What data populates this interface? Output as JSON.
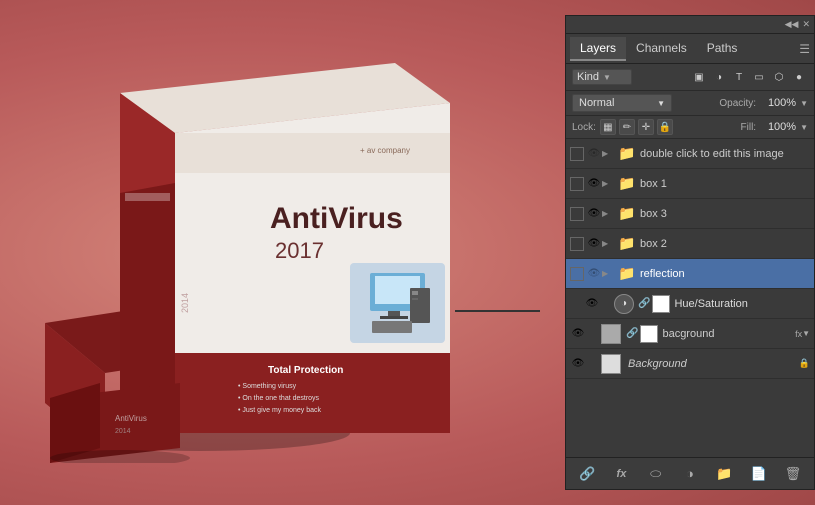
{
  "background_color": "#c97070",
  "panel": {
    "title": "Layers",
    "tabs": [
      {
        "label": "Layers",
        "active": true
      },
      {
        "label": "Channels",
        "active": false
      },
      {
        "label": "Paths",
        "active": false
      }
    ],
    "kind_label": "Kind",
    "blend_mode": "Normal",
    "opacity_label": "Opacity:",
    "opacity_value": "100%",
    "lock_label": "Lock:",
    "fill_label": "Fill:",
    "fill_value": "100%",
    "layers": [
      {
        "id": "layer-double-click",
        "visible": false,
        "has_eye": false,
        "has_arrow": true,
        "type": "folder",
        "name": "double click to edit this image",
        "italic": false,
        "indented": false
      },
      {
        "id": "layer-box1",
        "visible": true,
        "has_eye": true,
        "has_arrow": true,
        "type": "folder",
        "name": "box 1",
        "italic": false,
        "indented": false
      },
      {
        "id": "layer-box3",
        "visible": true,
        "has_eye": true,
        "has_arrow": true,
        "type": "folder",
        "name": "box 3",
        "italic": false,
        "indented": false
      },
      {
        "id": "layer-box2",
        "visible": true,
        "has_eye": true,
        "has_arrow": true,
        "type": "folder",
        "name": "box 2",
        "italic": false,
        "indented": false
      },
      {
        "id": "layer-reflection",
        "visible": false,
        "has_eye": false,
        "has_arrow": true,
        "type": "folder",
        "name": "reflection",
        "italic": false,
        "selected": true,
        "indented": false
      },
      {
        "id": "layer-huesat",
        "visible": true,
        "has_eye": true,
        "has_arrow": false,
        "type": "adjustment",
        "name": "Hue/Saturation",
        "italic": false,
        "indented": true,
        "has_mask": true
      },
      {
        "id": "layer-background-lower",
        "visible": true,
        "has_eye": true,
        "has_arrow": false,
        "type": "normal",
        "name": "bacground",
        "italic": false,
        "indented": false,
        "has_mask": true,
        "has_fx": true
      },
      {
        "id": "layer-background",
        "visible": true,
        "has_eye": true,
        "has_arrow": false,
        "type": "normal",
        "name": "Background",
        "italic": true,
        "indented": false,
        "has_lock": true
      }
    ],
    "bottom_icons": [
      "link",
      "fx",
      "circle-half",
      "circle-dot",
      "folder",
      "page",
      "trash"
    ]
  },
  "box": {
    "brand": "av company",
    "brand_prefix": "+ ",
    "title": "AntiVirus",
    "year": "2017",
    "series": "2014",
    "tagline": "Total Protection",
    "bullets": [
      "Something virusy",
      "On the one that destroys",
      "Just give my money back"
    ]
  }
}
